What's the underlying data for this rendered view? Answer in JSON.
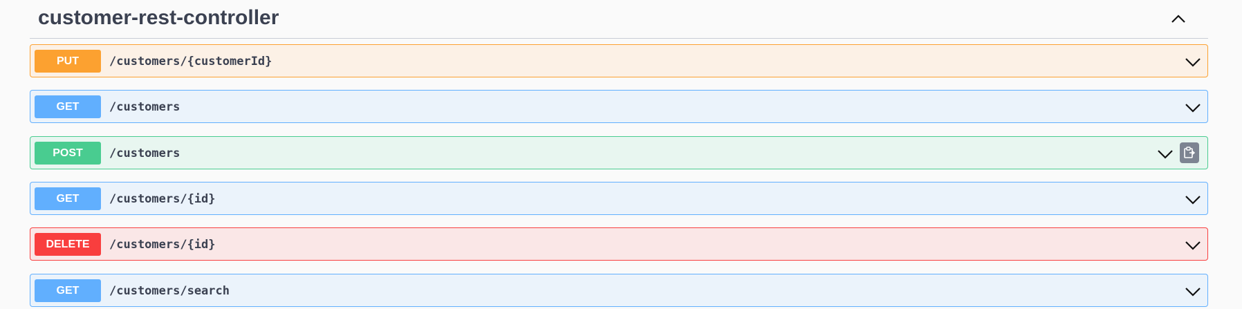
{
  "section": {
    "title": "customer-rest-controller",
    "collapse_icon": "chevron-up-icon"
  },
  "operations": [
    {
      "method": "PUT",
      "path": "/customers/{customerId}",
      "color": "#fca130"
    },
    {
      "method": "GET",
      "path": "/customers",
      "color": "#61affe"
    },
    {
      "method": "POST",
      "path": "/customers",
      "color": "#49cc90",
      "copy_icon": "clipboard-icon"
    },
    {
      "method": "GET",
      "path": "/customers/{id}",
      "color": "#61affe"
    },
    {
      "method": "DELETE",
      "path": "/customers/{id}",
      "color": "#f93e3e"
    },
    {
      "method": "GET",
      "path": "/customers/search",
      "color": "#61affe"
    }
  ]
}
